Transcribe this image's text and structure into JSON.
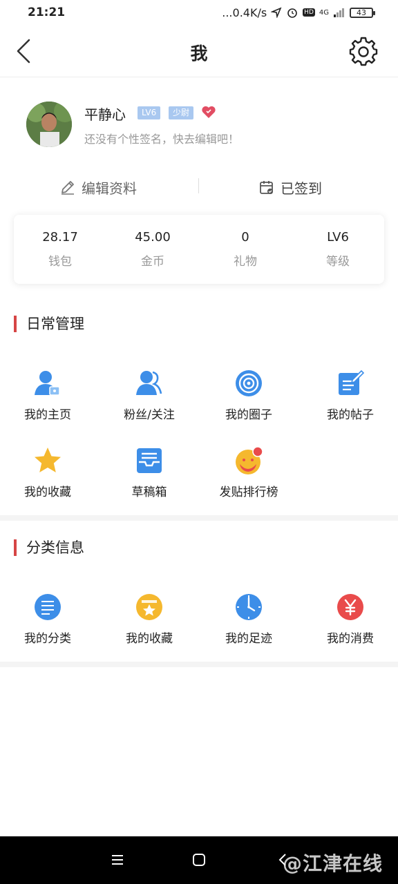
{
  "status_bar": {
    "time": "21:21",
    "network_speed": "...0.4K/s",
    "network_type": "4G",
    "hd": "HD",
    "battery": "43"
  },
  "header": {
    "title": "我"
  },
  "profile": {
    "name": "平静心",
    "level_badge": "LV6",
    "rank_badge": "少尉",
    "signature": "还没有个性签名，快去编辑吧！"
  },
  "actions": {
    "edit": "编辑资料",
    "sign_in": "已签到"
  },
  "stats": [
    {
      "value": "28.17",
      "label": "钱包"
    },
    {
      "value": "45.00",
      "label": "金币"
    },
    {
      "value": "0",
      "label": "礼物"
    },
    {
      "value": "LV6",
      "label": "等级"
    }
  ],
  "daily": {
    "title": "日常管理",
    "items": [
      {
        "label": "我的主页",
        "icon": "user-home-icon"
      },
      {
        "label": "粉丝/关注",
        "icon": "fans-icon"
      },
      {
        "label": "我的圈子",
        "icon": "circle-icon"
      },
      {
        "label": "我的帖子",
        "icon": "post-edit-icon"
      },
      {
        "label": "我的收藏",
        "icon": "star-icon"
      },
      {
        "label": "草稿箱",
        "icon": "inbox-icon"
      },
      {
        "label": "发贴排行榜",
        "icon": "ranking-icon"
      }
    ]
  },
  "category": {
    "title": "分类信息",
    "items": [
      {
        "label": "我的分类",
        "icon": "list-icon"
      },
      {
        "label": "我的收藏",
        "icon": "star-box-icon"
      },
      {
        "label": "我的足迹",
        "icon": "clock-icon"
      },
      {
        "label": "我的消费",
        "icon": "yuan-icon"
      }
    ]
  },
  "watermark": "@江津在线",
  "colors": {
    "accent_red": "#d64545",
    "icon_blue": "#3d8ee8",
    "badge_blue": "#a9c8f0",
    "star_yellow": "#f5b82e",
    "yuan_red": "#e94b4b"
  }
}
